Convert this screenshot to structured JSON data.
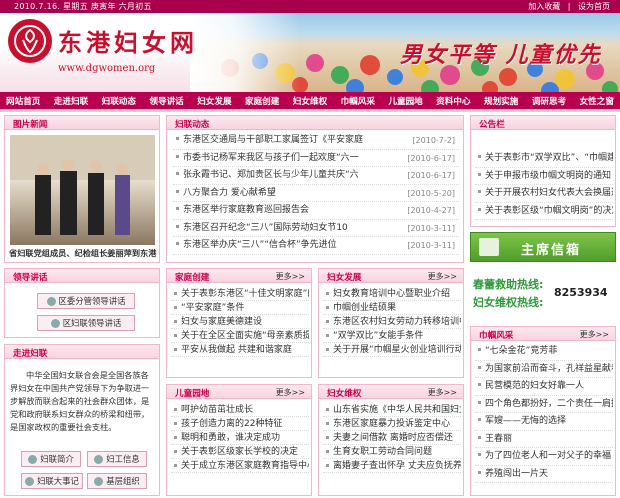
{
  "topbar": {
    "date": "2010.7.16. 星期五 庚寅年 六月初五",
    "favorite": "加入收藏",
    "sep": "|",
    "homepage": "设为首页"
  },
  "header": {
    "site_name": "东港妇女网",
    "url": "www.dgwomen.org",
    "slogan": "男女平等 儿童优先"
  },
  "nav": [
    "网站首页",
    "走进妇联",
    "妇联动态",
    "领导讲话",
    "妇女发展",
    "家庭创建",
    "妇女维权",
    "巾帼风采",
    "儿童园地",
    "资料中心",
    "规划实施",
    "调研思考",
    "女性之窗"
  ],
  "photo_news": {
    "title": "图片新闻",
    "caption": "省妇联党组成员、纪检组长姜丽萍到东港"
  },
  "leader": {
    "title": "领导讲话",
    "buttons": [
      "区委分管领导讲话",
      "区妇联领导讲话"
    ]
  },
  "intro": {
    "title": "走进妇联",
    "text": "中华全国妇女联合会是全国各族各界妇女在中国共产党领导下为争取进一步解放而联合起来的社会群众团体，是党和政府联系妇女群众的桥梁和纽带，是国家政权的重要社会支柱。",
    "buttons": [
      "妇联简介",
      "妇工信息",
      "妇联大事记",
      "基层组织"
    ]
  },
  "dynamic": {
    "title": "妇联动态",
    "items": [
      {
        "text": "东港区交通局与干部职工家属签订《平安家庭",
        "date": "[2010-7-2]"
      },
      {
        "text": "市委书记杨军来我区与孩子们一起欢度“六一",
        "date": "[2010-6-17]"
      },
      {
        "text": "张永霞书记、郑加贵区长与少年儿童共庆“六",
        "date": "[2010-6-17]"
      },
      {
        "text": "八方聚合力 爱心献希望",
        "date": "[2010-5-20]"
      },
      {
        "text": "东港区举行家庭教育巡回报告会",
        "date": "[2010-4-27]"
      },
      {
        "text": "东港区召开纪念“三八”国际劳动妇女节10",
        "date": "[2010-3-11]"
      },
      {
        "text": "东港区举办庆“三八”“信合杯”争先进位",
        "date": "[2010-3-11]"
      }
    ]
  },
  "family": {
    "title": "家庭创建",
    "more": "更多>>",
    "items": [
      "关于表彰东港区“十佳文明家庭”的",
      "“平安家庭”条件",
      "妇女与家庭美德建设",
      "关于在全区全面实施“母亲素质提升",
      "平安从我做起 共建和谐家庭"
    ]
  },
  "women_dev": {
    "title": "妇女发展",
    "more": "更多>>",
    "items": [
      "妇女教育培训中心暨职业介绍",
      "巾帼创业结硕果",
      "东港区农村妇女劳动力转移培训中心",
      "“双学双比”女能手条件",
      "关于开展“巾帼星火创业培训行动”"
    ]
  },
  "children": {
    "title": "儿童园地",
    "more": "更多>>",
    "items": [
      "呵护幼苗茁壮成长",
      "孩子创造力离的22种特征",
      "聪明和勇敢，谁决定成功",
      "关于表彰区级家长学校的决定",
      "关于成立东港区家庭教育指导中心方"
    ]
  },
  "rights": {
    "title": "妇女维权",
    "more": "更多>>",
    "items": [
      "山东省实施《中华人民共和国妇女权",
      "东港区家庭暴力投诉鉴定中心",
      "夫妻之间借款 离婚时应否偿还",
      "生育女职工劳动合同问题",
      "离婚妻子查出怀孕 丈夫应负抚养义"
    ]
  },
  "notice": {
    "title": "公告栏",
    "items": [
      "关于表彰市“双学双比”、“巾帼建",
      "关于申报市级巾帼文明岗的通知",
      "关于开展农村妇女代表大会换届选举",
      "关于表彰区级“巾帼文明岗”的决定"
    ]
  },
  "mailbox": {
    "label": "主席信箱"
  },
  "hotline": {
    "line1": "春蕾救助热线:",
    "line2": "妇女维权热线:",
    "number": "8253934"
  },
  "demeanor": {
    "title": "巾帼风采",
    "more": "更多>>",
    "items": [
      "“七朵金花”竞芳菲",
      "为国家前沿而奋斗，孔祥益星献春",
      "民营模范的妇女好靠一人",
      "四个角色都扮好，二个责任一肩挑",
      "军嫂——无悔的选择",
      "王春丽",
      "为了四位老人和一对父子的幸福",
      "养殖闯出一片天"
    ]
  }
}
